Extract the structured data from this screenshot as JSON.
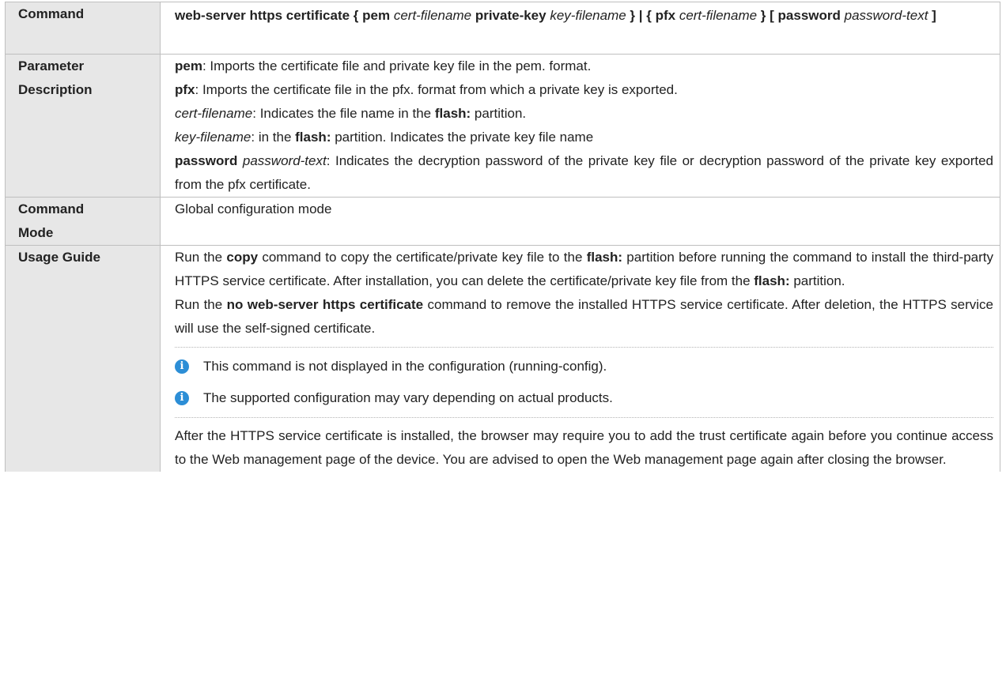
{
  "rows": {
    "command": {
      "label": "Command",
      "parts": [
        {
          "t": "web-server https certificate { pem ",
          "s": "b"
        },
        {
          "t": "cert-filename",
          "s": "i"
        },
        {
          "t": " private-key ",
          "s": "b"
        },
        {
          "t": "key-filename",
          "s": "i"
        },
        {
          "t": " } | { pfx ",
          "s": "b"
        },
        {
          "t": "cert-filename",
          "s": "i"
        },
        {
          "t": " }",
          "s": "b"
        },
        {
          "t": " [ password ",
          "s": "b"
        },
        {
          "t": "password-text",
          "s": "i"
        },
        {
          "t": " ]",
          "s": "b"
        }
      ]
    },
    "param": {
      "label_line1": "Parameter",
      "label_line2": "Description",
      "lines": [
        [
          {
            "t": "pem",
            "s": "b"
          },
          {
            "t": ": Imports the certificate file and private key file in the pem. format.",
            "s": "n"
          }
        ],
        [
          {
            "t": "pfx",
            "s": "b"
          },
          {
            "t": ": Imports the certificate file in the pfx. format from which a private key is exported.",
            "s": "n"
          }
        ],
        [
          {
            "t": "cert-filename",
            "s": "i"
          },
          {
            "t": ": Indicates the file name in the ",
            "s": "n"
          },
          {
            "t": "flash:",
            "s": "b"
          },
          {
            "t": " partition.",
            "s": "n"
          }
        ],
        [
          {
            "t": "key-filename",
            "s": "i"
          },
          {
            "t": ": in the ",
            "s": "n"
          },
          {
            "t": "flash:",
            "s": "b"
          },
          {
            "t": " partition. Indicates the private key file name",
            "s": "n"
          }
        ],
        [
          {
            "t": "password",
            "s": "b"
          },
          {
            "t": " ",
            "s": "n"
          },
          {
            "t": "password-text",
            "s": "i"
          },
          {
            "t": ": Indicates the decryption password of the private key file or decryption password of the private key exported from the pfx certificate.",
            "s": "n"
          }
        ]
      ]
    },
    "mode": {
      "label_line1": "Command",
      "label_line2": "Mode",
      "text": "Global configuration mode"
    },
    "usage": {
      "label": "Usage Guide",
      "para1": [
        {
          "t": "Run the ",
          "s": "n"
        },
        {
          "t": "copy",
          "s": "b"
        },
        {
          "t": " command to copy the certificate/private key file to the ",
          "s": "n"
        },
        {
          "t": "flash:",
          "s": "b"
        },
        {
          "t": " partition before running the command to install the third-party HTTPS service certificate. After installation, you can delete the certificate/private key file from the ",
          "s": "n"
        },
        {
          "t": "flash:",
          "s": "b"
        },
        {
          "t": " partition.",
          "s": "n"
        }
      ],
      "para2": [
        {
          "t": "Run the ",
          "s": "n"
        },
        {
          "t": "no web-server https certificate",
          "s": "b"
        },
        {
          "t": " command to remove the installed HTTPS service certificate. After deletion, the HTTPS service will use the self-signed certificate.",
          "s": "n"
        }
      ],
      "notes": [
        "This command is not displayed in the configuration (running-config).",
        "The supported configuration may vary depending on actual products."
      ],
      "para3": "After the HTTPS service certificate is installed, the browser may require you to add the trust certificate again before you continue access to the Web management page of the device. You are advised to open the Web management page again after closing the browser."
    }
  },
  "icons": {
    "note_icon": "info-icon",
    "note_icon_glyph": "i",
    "note_icon_color": "#2c8ed6"
  },
  "colors": {
    "header_bg": "#e7e7e7",
    "border": "#bfbfbf"
  }
}
